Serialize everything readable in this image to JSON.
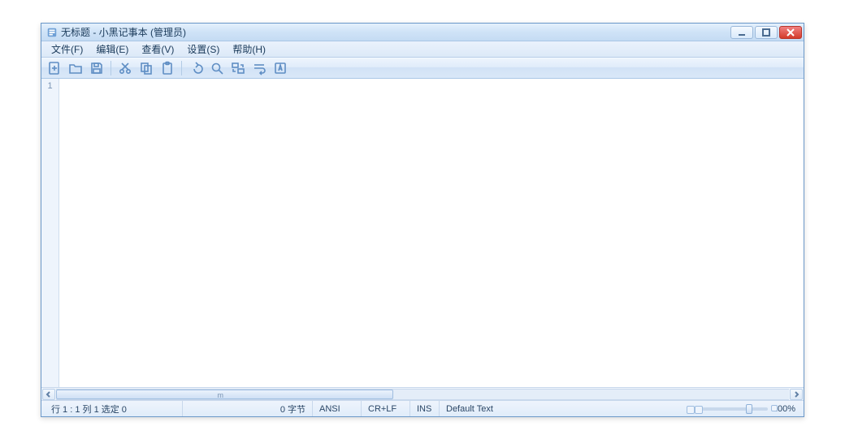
{
  "window": {
    "title": "无标题 - 小黑记事本 (管理员)"
  },
  "menubar": {
    "items": [
      {
        "label": "文件(F)"
      },
      {
        "label": "编辑(E)"
      },
      {
        "label": "查看(V)"
      },
      {
        "label": "设置(S)"
      },
      {
        "label": "帮助(H)"
      }
    ]
  },
  "toolbar": {
    "icons": [
      "new-file-icon",
      "open-file-icon",
      "save-icon",
      "cut-icon",
      "copy-icon",
      "paste-icon",
      "undo-icon",
      "find-icon",
      "replace-icon",
      "word-wrap-icon",
      "font-icon"
    ]
  },
  "editor": {
    "line_number": "1",
    "content": ""
  },
  "hscroll": {
    "mid_label": "m"
  },
  "statusbar": {
    "position": "行 1 : 1  列 1  选定 0",
    "size": "0 字节",
    "encoding": "ANSI",
    "newline": "CR+LF",
    "insert_mode": "INS",
    "language": "Default Text",
    "zoom": "100%"
  }
}
